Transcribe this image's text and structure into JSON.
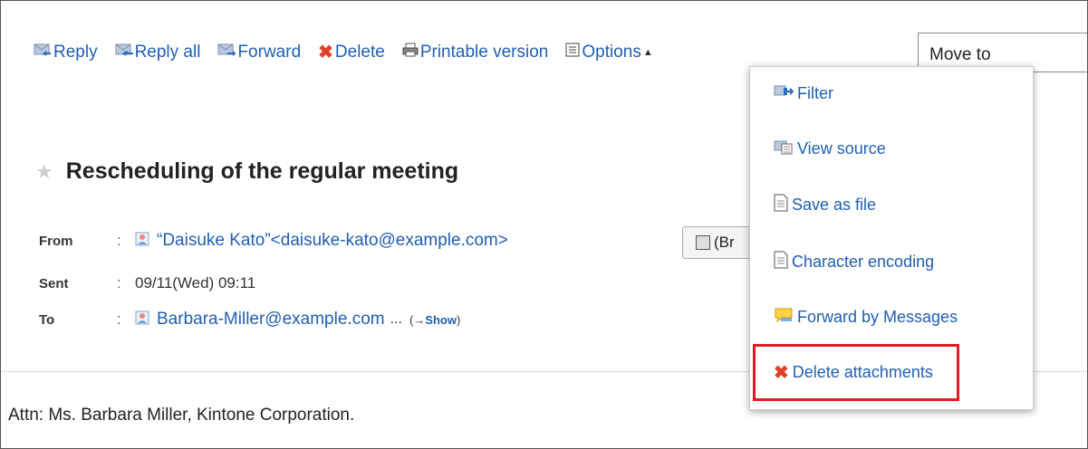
{
  "toolbar": {
    "reply": "Reply",
    "reply_all": "Reply all",
    "forward": "Forward",
    "delete": "Delete",
    "printable": "Printable version",
    "options": "Options",
    "options_arrow": "▲"
  },
  "move_to": {
    "value": "Move to"
  },
  "message": {
    "subject": "Rescheduling of the regular meeting",
    "star": "★",
    "from_label": "From",
    "from_value": "“Daisuke Kato”<daisuke-kato@example.com>",
    "sent_label": "Sent",
    "sent_value": "09/11(Wed) 09:11",
    "to_label": "To",
    "to_value": "Barbara-Miller@example.com",
    "to_more": "...",
    "show_prefix": "(→",
    "show_label": "Show",
    "show_suffix": ")",
    "separator": ":",
    "browse_button": "(Br",
    "body": "Attn: Ms. Barbara Miller, Kintone Corporation."
  },
  "options_menu": {
    "items": [
      {
        "label": "Filter",
        "icon": "filter-icon"
      },
      {
        "label": "View source",
        "icon": "view-source-icon"
      },
      {
        "label": "Save as file",
        "icon": "document-icon"
      },
      {
        "label": "Character encoding",
        "icon": "document-icon"
      },
      {
        "label": "Forward by Messages",
        "icon": "speech-bubble-icon"
      },
      {
        "label": "Delete attachments",
        "icon": "delete-x-icon"
      }
    ]
  },
  "colors": {
    "link": "#1f5fb3",
    "delete_red": "#e0402a",
    "highlight_red": "#e01b22"
  }
}
